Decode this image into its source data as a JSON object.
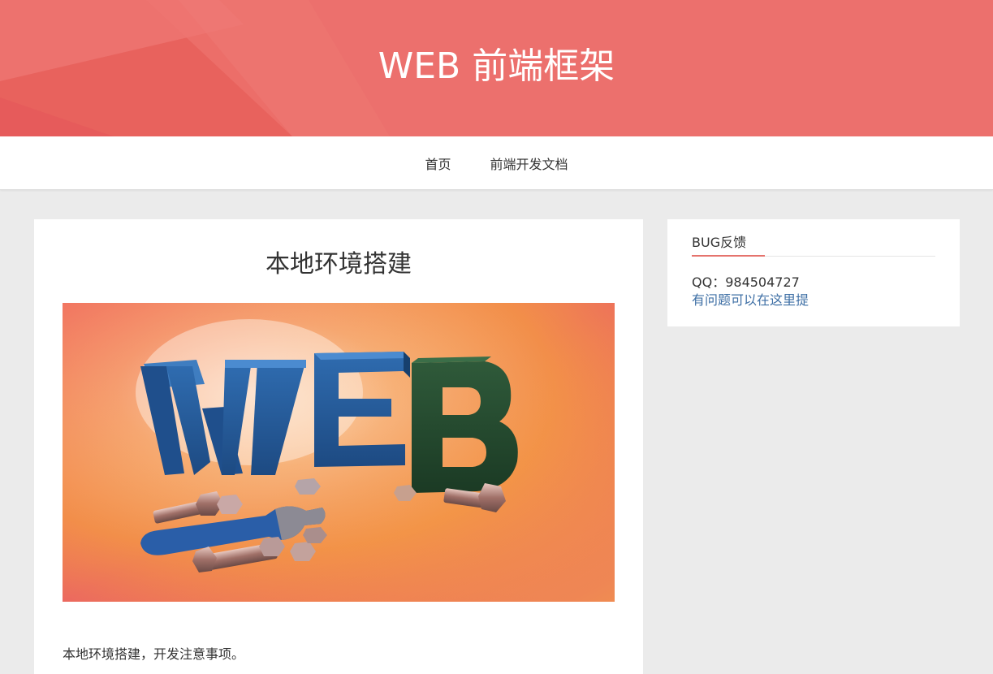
{
  "header": {
    "site_title": "WEB 前端框架"
  },
  "nav": {
    "items": [
      {
        "label": "首页"
      },
      {
        "label": "前端开发文档"
      }
    ]
  },
  "post": {
    "title": "本地环境搭建",
    "image": {
      "letters": [
        "W",
        "E",
        "B"
      ]
    },
    "excerpt": "本地环境搭建，开发注意事项。"
  },
  "sidebar": {
    "widget_title": "BUG反馈",
    "qq_label": "QQ：",
    "qq_number": "984504727",
    "link_text": "有问题可以在这里提"
  },
  "colors": {
    "banner": "#ec706d",
    "accent": "#e5736d",
    "link": "#3e6fa5",
    "background": "#ebebeb"
  }
}
